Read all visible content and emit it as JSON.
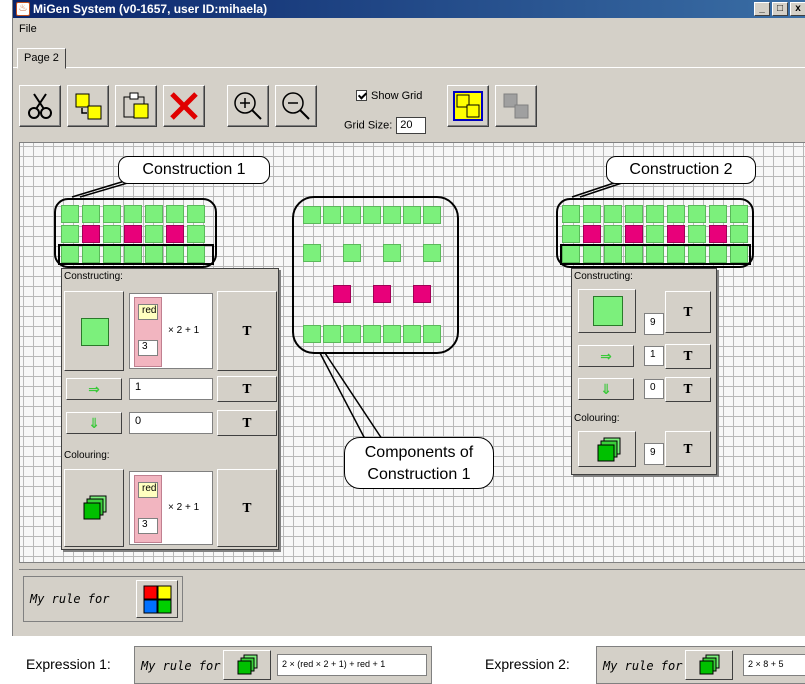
{
  "window": {
    "title": "MiGen System (v0-1657, user ID:mihaela)",
    "min_label": "_",
    "max_label": "□",
    "close_label": "x"
  },
  "menu": {
    "file": "File"
  },
  "tabs": [
    {
      "label": "Page 2"
    }
  ],
  "toolbar": {
    "icons": [
      "cut-icon",
      "copy-icon",
      "paste-icon",
      "delete-icon",
      "zoom-in-icon",
      "zoom-out-icon",
      "group-icon",
      "ungroup-icon"
    ],
    "show_grid_label": "Show Grid",
    "show_grid_checked": true,
    "grid_size_label": "Grid Size:",
    "grid_size_value": "20"
  },
  "callouts": {
    "construction1": "Construction 1",
    "construction2": "Construction 2",
    "components": "Components of\nConstruction 1"
  },
  "panel1": {
    "constructing_label": "Constructing:",
    "colouring_label": "Colouring:",
    "repeat_var": "red",
    "repeat_val": "3",
    "repeat_expr": "× 2 + 1",
    "move_right": "1",
    "move_down": "0",
    "colour_var": "red",
    "colour_val": "3",
    "colour_expr": "× 2 + 1",
    "t_label": "T"
  },
  "panel2": {
    "constructing_label": "Constructing:",
    "colouring_label": "Colouring:",
    "repeat_val": "9",
    "move_right": "1",
    "move_down": "0",
    "colour_val": "9",
    "t_label": "T"
  },
  "rulebar": {
    "label": "My rule for"
  },
  "expressions": {
    "label1": "Expression 1:",
    "rule1": "My rule for",
    "value1": "2 × (red × 2 + 1) + red + 1",
    "label2": "Expression 2:",
    "rule2": "My rule for",
    "value2": "2 × 8 + 5"
  },
  "colors": {
    "tile_green": "#7cf07c",
    "tile_pink": "#e8007a",
    "window_bg": "#d4d0c8",
    "titlebar": "#0a246a"
  }
}
